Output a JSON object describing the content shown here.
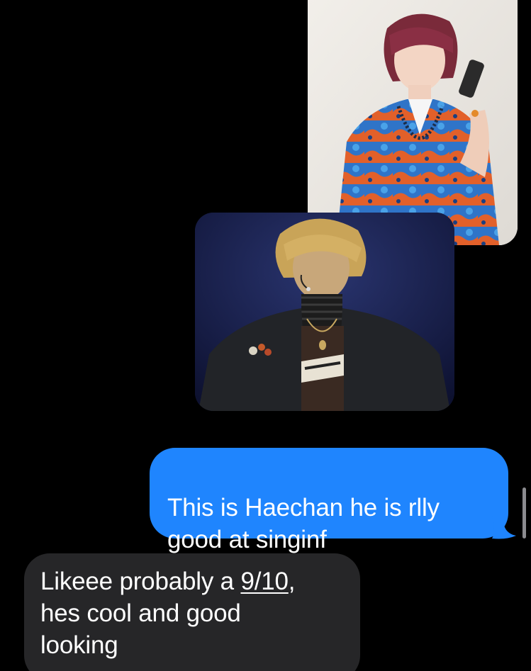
{
  "conversation": {
    "photos": [
      {
        "subject": "person in blue floral shirt holding flip phone"
      },
      {
        "subject": "performer on stage with headset mic"
      }
    ],
    "messages": [
      {
        "sender": "me",
        "text": "This is Haechan he is rlly\ngood at singinf"
      },
      {
        "sender": "them",
        "text_before": "Likeee probably a ",
        "link": "9/10",
        "text_after": ",\nhes cool and good\nlooking"
      }
    ]
  },
  "colors": {
    "sent_bubble": "#1f85fe",
    "received_bubble": "#262628",
    "background": "#000000"
  }
}
